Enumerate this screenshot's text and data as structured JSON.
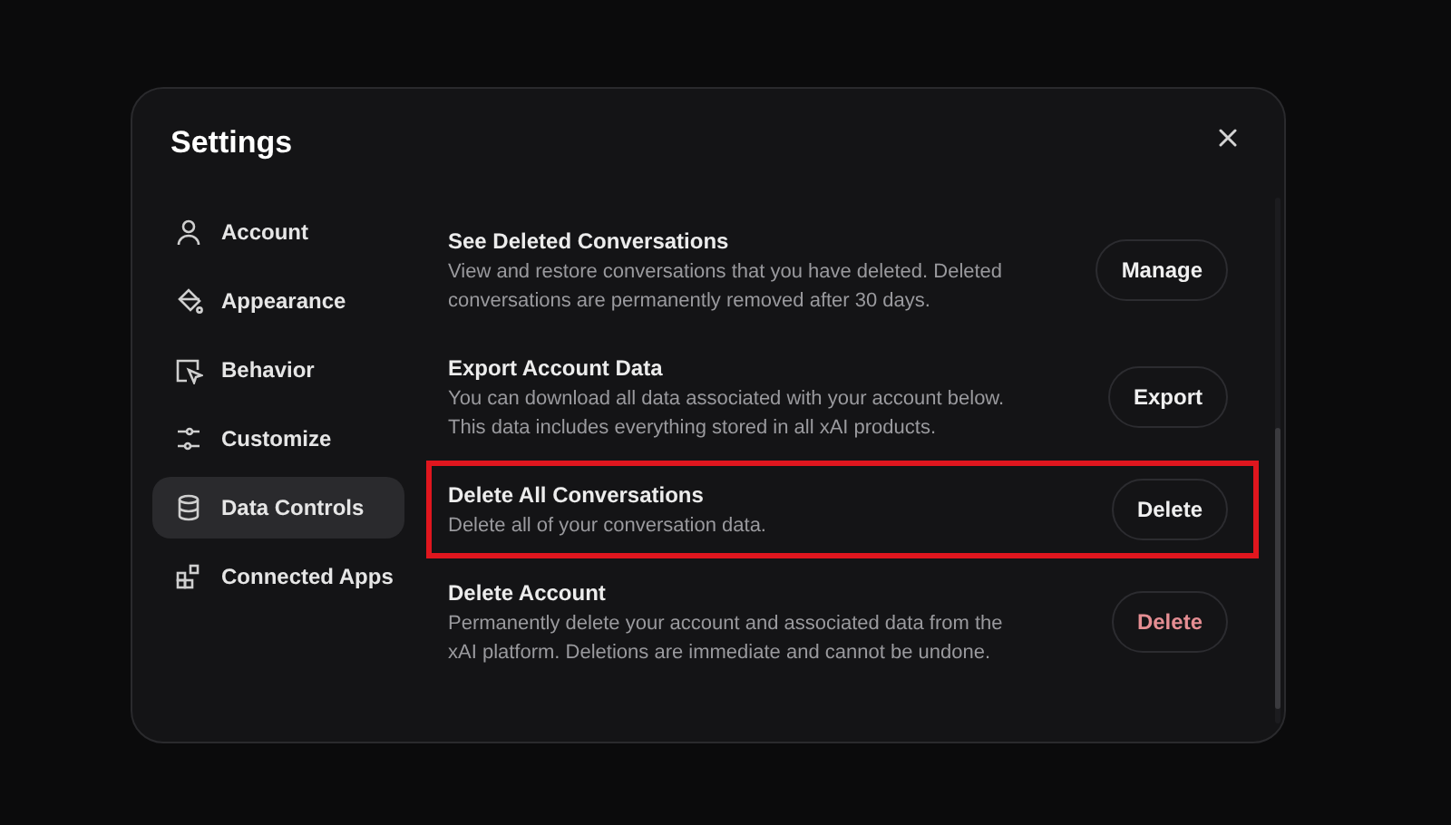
{
  "title": "Settings",
  "sidebar": {
    "items": [
      {
        "label": "Account",
        "selected": false
      },
      {
        "label": "Appearance",
        "selected": false
      },
      {
        "label": "Behavior",
        "selected": false
      },
      {
        "label": "Customize",
        "selected": false
      },
      {
        "label": "Data Controls",
        "selected": true
      },
      {
        "label": "Connected Apps",
        "selected": false
      }
    ]
  },
  "rows": [
    {
      "title": "See Deleted Conversations",
      "description": "View and restore conversations that you have deleted. Deleted conversations are permanently removed after 30 days.",
      "button": "Manage",
      "kind": "normal",
      "highlighted": false
    },
    {
      "title": "Export Account Data",
      "description": "You can download all data associated with your account below. This data includes everything stored in all xAI products.",
      "button": "Export",
      "kind": "normal",
      "highlighted": false
    },
    {
      "title": "Delete All Conversations",
      "description": "Delete all of your conversation data.",
      "button": "Delete",
      "kind": "normal",
      "highlighted": true
    },
    {
      "title": "Delete Account",
      "description": "Permanently delete your account and associated data from the xAI platform. Deletions are immediate and cannot be undone.",
      "button": "Delete",
      "kind": "danger",
      "highlighted": false
    }
  ]
}
